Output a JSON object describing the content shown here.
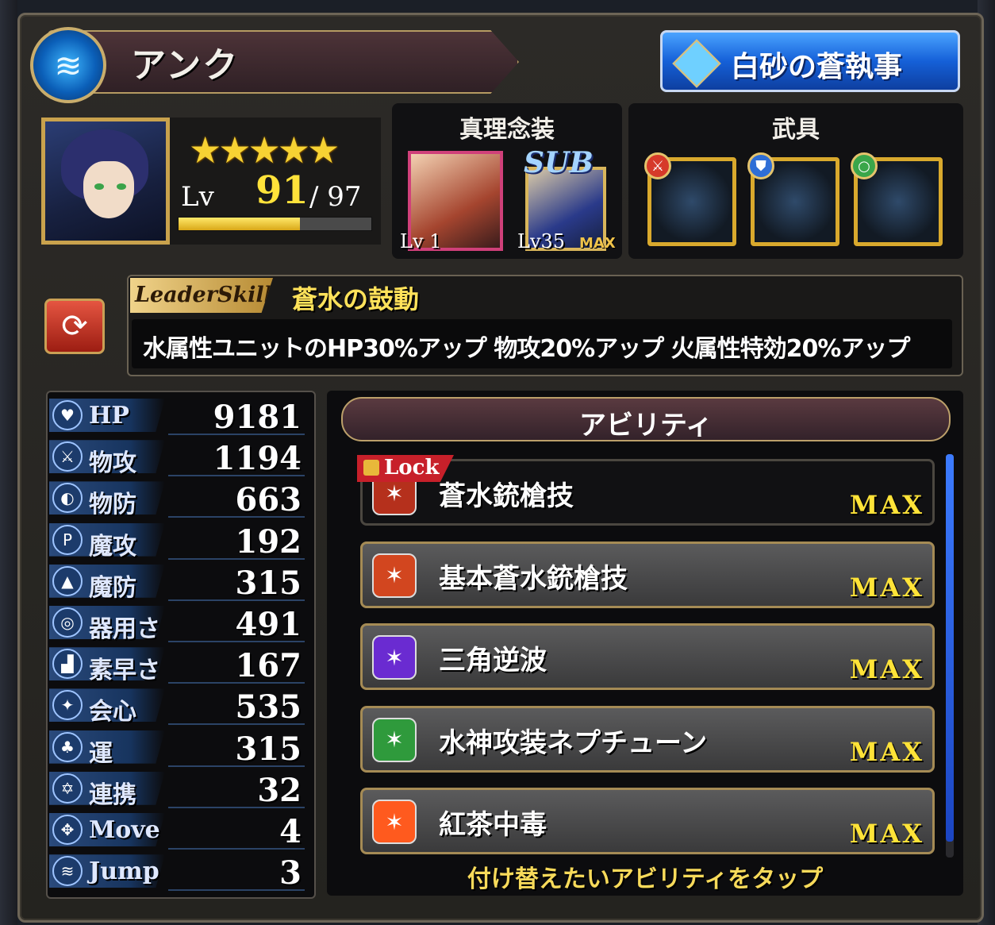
{
  "character": {
    "name": "アンク",
    "title": "白砂の蒼執事",
    "stars": "★★★★★",
    "level_label": "Lv",
    "level": "91",
    "level_max": "/ 97",
    "level_progress": 0.63
  },
  "truth_gear": {
    "heading": "真理念装",
    "main_level": "Lv 1",
    "sub_label": "SUB",
    "sub_level": "Lv35",
    "sub_max": "MAX"
  },
  "equipment": {
    "heading": "武具",
    "slots": [
      {
        "type": "sword-icon",
        "color": "#d63a2a"
      },
      {
        "type": "shield-icon",
        "color": "#2f6ed6"
      },
      {
        "type": "ring-icon",
        "color": "#3aa64a"
      }
    ]
  },
  "leader_skill": {
    "tag": "LeaderSkill",
    "name": "蒼水の鼓動",
    "description": "水属性ユニットのHP30%アップ 物攻20%アップ 火属性特効20%アップ"
  },
  "stats": [
    {
      "label": "HP",
      "value": "9181",
      "icon": "♥"
    },
    {
      "label": "物攻",
      "value": "1194",
      "icon": "⚔"
    },
    {
      "label": "物防",
      "value": "663",
      "icon": "◐"
    },
    {
      "label": "魔攻",
      "value": "192",
      "icon": "P"
    },
    {
      "label": "魔防",
      "value": "315",
      "icon": "▲"
    },
    {
      "label": "器用さ",
      "value": "491",
      "icon": "◎"
    },
    {
      "label": "素早さ",
      "value": "167",
      "icon": "▟"
    },
    {
      "label": "会心",
      "value": "535",
      "icon": "✦"
    },
    {
      "label": "運",
      "value": "315",
      "icon": "♣"
    },
    {
      "label": "連携",
      "value": "32",
      "icon": "✡"
    },
    {
      "label": "Move",
      "value": "4",
      "icon": "✥"
    },
    {
      "label": "Jump",
      "value": "3",
      "icon": "≋"
    }
  ],
  "abilities": {
    "heading": "アビリティ",
    "lock_label": "Lock",
    "items": [
      {
        "name": "蒼水銃槍技",
        "level": "MAX",
        "color": "#b5301c"
      },
      {
        "name": "基本蒼水銃槍技",
        "level": "MAX",
        "color": "#d2461f"
      },
      {
        "name": "三角逆波",
        "level": "MAX",
        "color": "#6a2bd1"
      },
      {
        "name": "水神攻装ネプチューン",
        "level": "MAX",
        "color": "#2f9a3c"
      },
      {
        "name": "紅茶中毒",
        "level": "MAX",
        "color": "#ff5a1e"
      }
    ],
    "hint": "付け替えたいアビリティをタップ"
  }
}
